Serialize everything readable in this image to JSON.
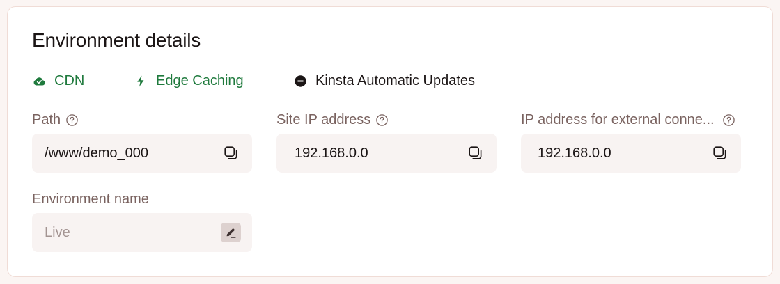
{
  "panel": {
    "title": "Environment details"
  },
  "features": [
    {
      "label": "CDN",
      "icon": "cloud-check-icon",
      "status": "enabled",
      "color": "#1f7a3d"
    },
    {
      "label": "Edge Caching",
      "icon": "lightning-icon",
      "status": "enabled",
      "color": "#1f7a3d"
    },
    {
      "label": "Kinsta Automatic Updates",
      "icon": "minus-circle-icon",
      "status": "disabled",
      "color": "#1b1515"
    }
  ],
  "fields": {
    "path": {
      "label": "Path",
      "value": "/www/demo_000"
    },
    "site_ip": {
      "label": "Site IP address",
      "value": "192.168.0.0"
    },
    "external_ip": {
      "label": "IP address for external conne...",
      "value": "192.168.0.0"
    },
    "environment_name": {
      "label": "Environment name",
      "value": "Live"
    }
  },
  "colors": {
    "background": "#fbf5f3",
    "field_background": "#f8f3f2",
    "label": "#7a6360",
    "accent_green": "#1f7a3d"
  }
}
